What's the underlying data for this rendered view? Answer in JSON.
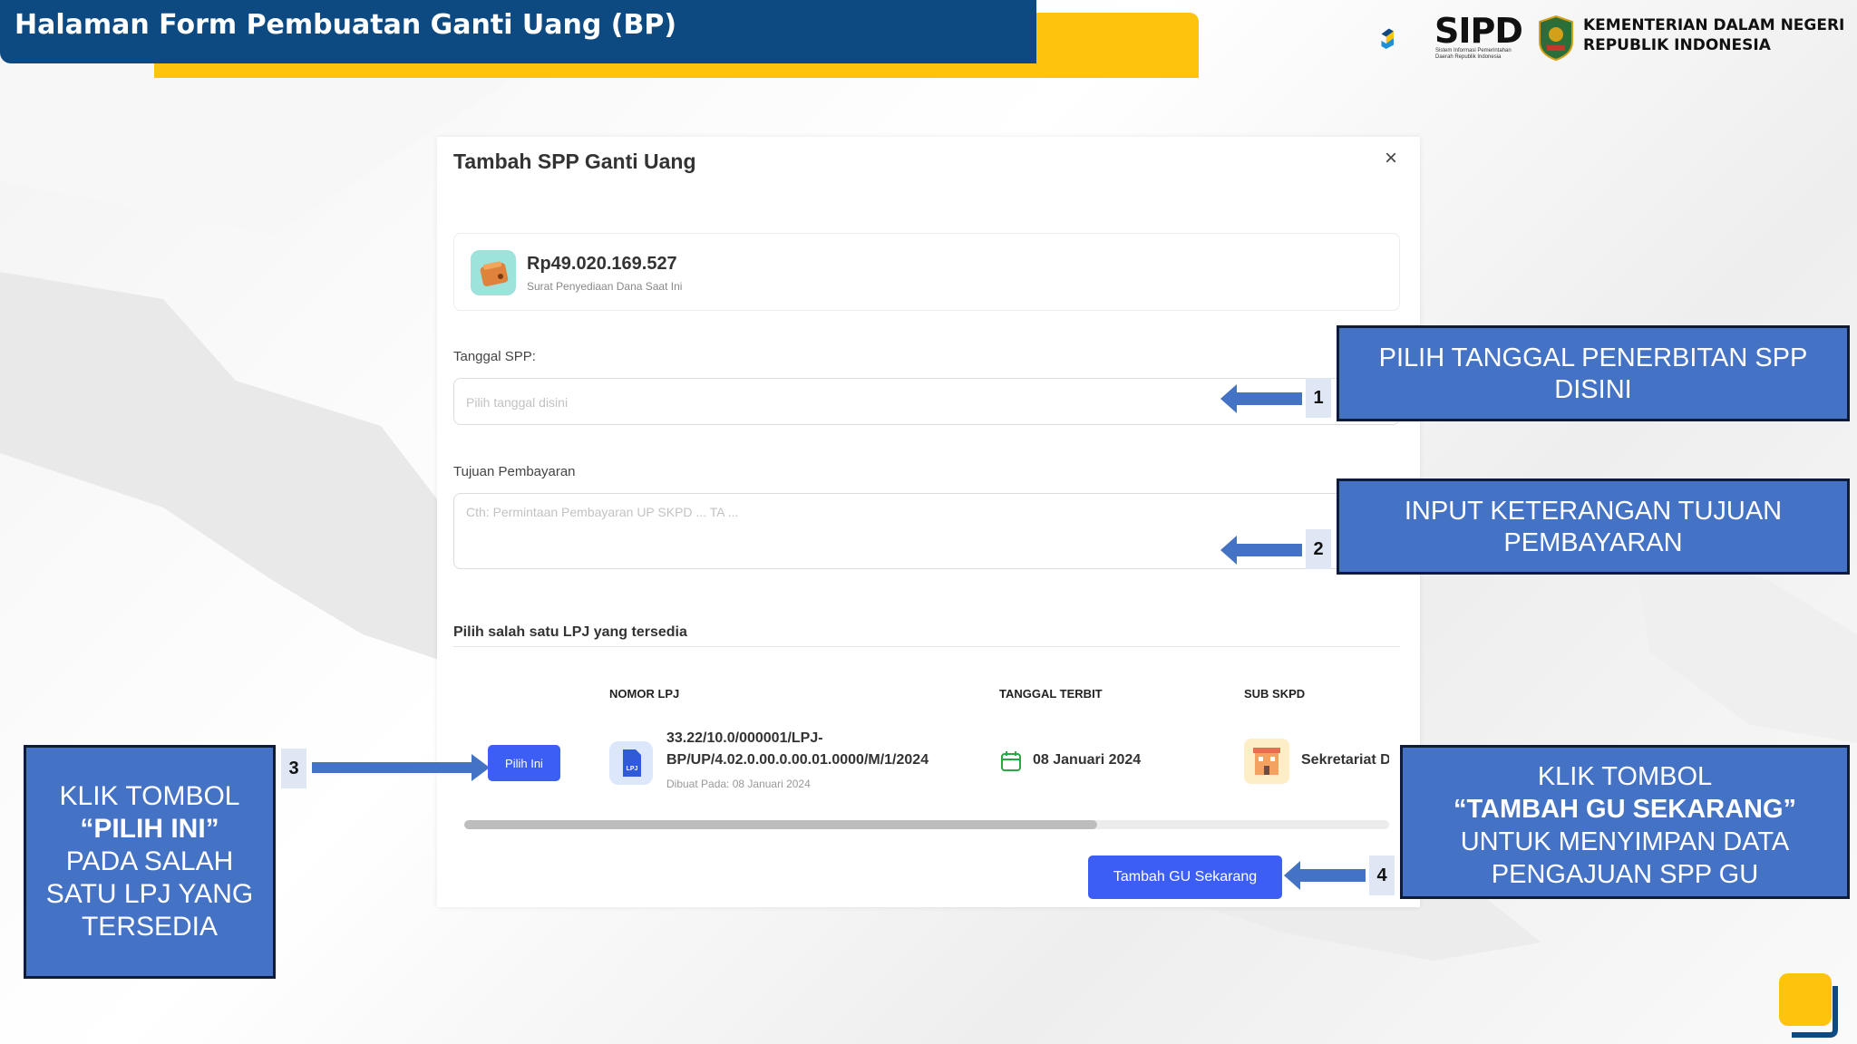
{
  "header": {
    "title": "Halaman Form Pembuatan Ganti Uang (BP)",
    "logo_name": "SIPD",
    "logo_subtitle": "Sistem Informasi Pemerintahan Daerah Republik Indonesia",
    "ministry_line1": "KEMENTERIAN DALAM NEGERI",
    "ministry_line2": "REPUBLIK INDONESIA"
  },
  "modal": {
    "title": "Tambah SPP Ganti Uang",
    "close_icon": "×",
    "balance": {
      "amount": "Rp49.020.169.527",
      "caption": "Surat Penyediaan Dana Saat Ini"
    },
    "tanggal_label": "Tanggal SPP:",
    "tanggal_placeholder": "Pilih tanggal disini",
    "tujuan_label": "Tujuan Pembayaran",
    "tujuan_placeholder": "Cth: Permintaan Pembayaran UP SKPD ... TA ...",
    "section_title": "Pilih salah satu LPJ yang tersedia",
    "table": {
      "headers": [
        "NOMOR LPJ",
        "TANGGAL TERBIT",
        "SUB SKPD"
      ],
      "rows": [
        {
          "action_label": "Pilih Ini",
          "lpj_icon_label": "LPJ",
          "nomor_line1": "33.22/10.0/000001/LPJ-",
          "nomor_line2": "BP/UP/4.02.0.00.0.00.01.0000/M/1/2024",
          "created": "Dibuat Pada: 08 Januari 2024",
          "tanggal": "08 Januari 2024",
          "sub_skpd": "Sekretariat D"
        }
      ]
    },
    "submit_label": "Tambah GU Sekarang"
  },
  "annotations": {
    "c1": {
      "number": "1",
      "line1": "PILIH TANGGAL PENERBITAN SPP",
      "line2": "DISINI"
    },
    "c2": {
      "number": "2",
      "line1": "INPUT KETERANGAN TUJUAN",
      "line2": "PEMBAYARAN"
    },
    "c3": {
      "number": "3",
      "line1": "KLIK TOMBOL",
      "line2": "“PILIH INI”",
      "line3": "PADA SALAH",
      "line4": "SATU LPJ YANG",
      "line5": "TERSEDIA"
    },
    "c4": {
      "number": "4",
      "line1": "KLIK TOMBOL",
      "line2": "“TAMBAH GU SEKARANG”",
      "line3": "UNTUK MENYIMPAN DATA",
      "line4": "PENGAJUAN SPP GU"
    }
  },
  "colors": {
    "header_blue": "#0e4a82",
    "header_yellow": "#fdc30d",
    "button_blue": "#3d5ef5",
    "callout_blue": "#4472c4"
  }
}
